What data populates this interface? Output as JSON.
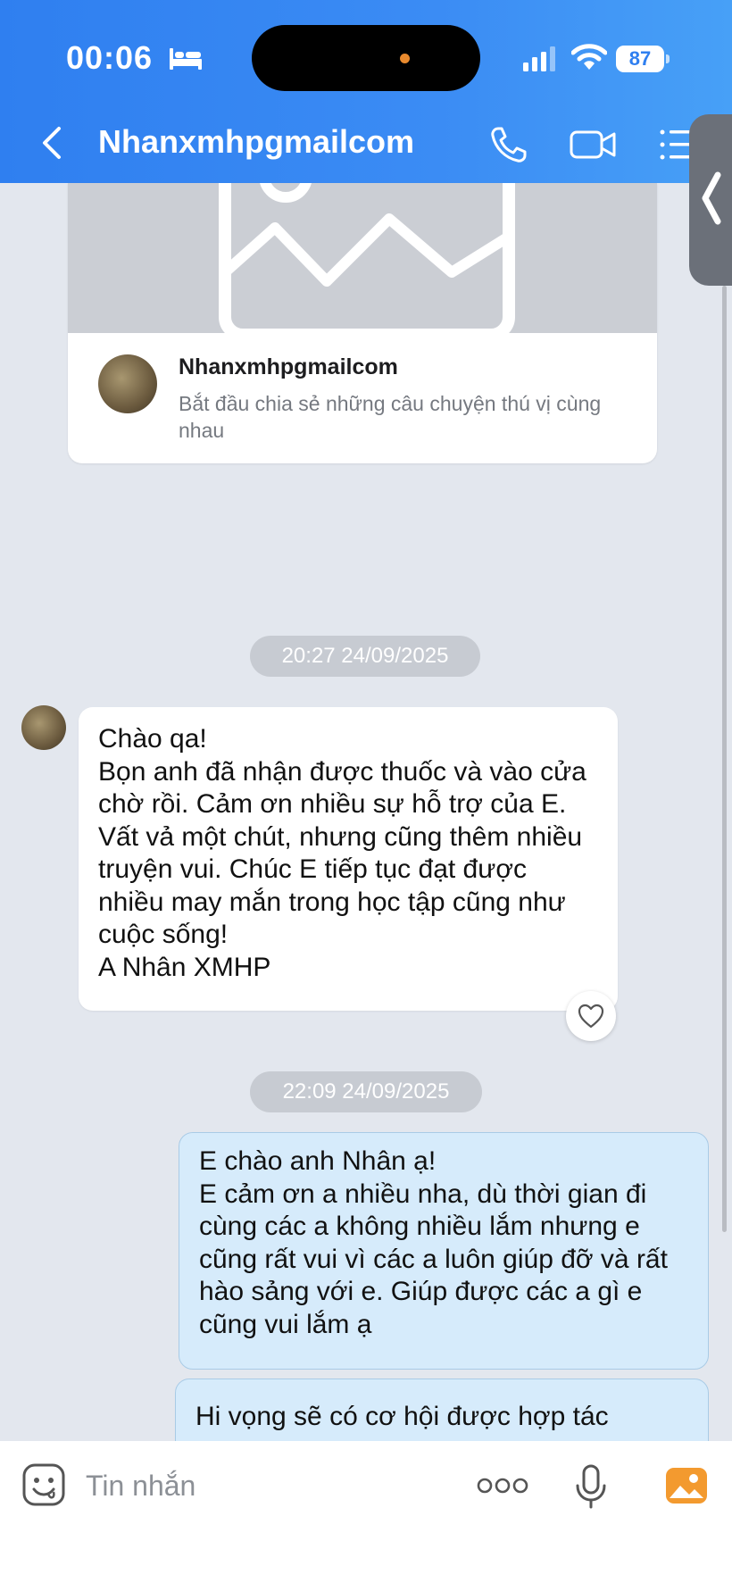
{
  "status_bar": {
    "time": "00:06",
    "battery": "87"
  },
  "header": {
    "title": "Nhanxmhpgmailcom"
  },
  "share_card": {
    "name": "Nhanxmhpgmailcom",
    "description": "Bắt đầu chia sẻ những câu chuyện thú vị cùng nhau"
  },
  "messages": [
    {
      "type": "timestamp",
      "text": "20:27 24/09/2025"
    },
    {
      "type": "received",
      "text": "Chào qa!\nBọn anh đã nhận được thuốc và vào cửa chờ rồi. Cảm ơn nhiều sự hỗ trợ của E. Vất vả một chút, nhưng cũng thêm nhiều truyện vui. Chúc E tiếp tục đạt được nhiều may mắn trong học tập cũng như cuộc sống!\nA Nhân XMHP"
    },
    {
      "type": "timestamp",
      "text": "22:09 24/09/2025"
    },
    {
      "type": "sent",
      "text": "E chào anh Nhân ạ!\nE cảm ơn a nhiều nha, dù thời gian đi cùng các a không nhiều lắm nhưng e cũng rất vui vì các a luôn giúp đỡ và rất hào sảng với e. Giúp được các a gì e cũng vui lắm ạ"
    },
    {
      "type": "sent",
      "text": "Hi vọng sẽ có cơ hội được hợp tác"
    }
  ],
  "composer": {
    "placeholder": "Tin nhắn"
  },
  "colors": {
    "header": "#3b8cf4",
    "sent_bubble": "#d6ebfb",
    "received_bubble": "#ffffff",
    "photo_icon": "#f39a2f"
  }
}
